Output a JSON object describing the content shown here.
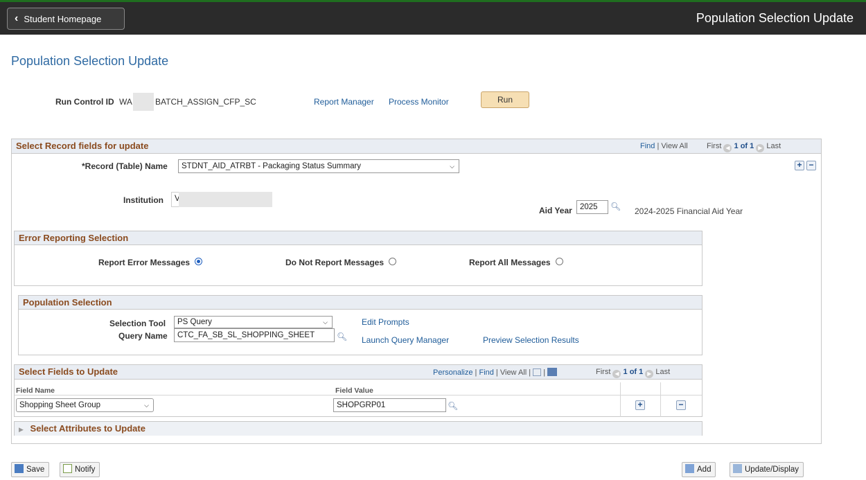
{
  "header": {
    "back_label": "Student Homepage",
    "title": "Population Selection Update"
  },
  "page_title": "Population Selection Update",
  "run_control": {
    "label": "Run Control ID",
    "value_prefix": "WA",
    "value_suffix": "BATCH_ASSIGN_CFP_SC",
    "report_manager": "Report Manager",
    "process_monitor": "Process Monitor",
    "run_label": "Run"
  },
  "record_section": {
    "title": "Select Record fields for update",
    "nav": {
      "find": "Find",
      "view_all": "View All",
      "first": "First",
      "count": "1 of 1",
      "last": "Last"
    },
    "record_label": "*Record (Table) Name",
    "record_value": "STDNT_AID_ATRBT - Packaging Status Summary",
    "institution_label": "Institution",
    "institution_value": "V",
    "aid_year_label": "Aid Year",
    "aid_year_value": "2025",
    "aid_year_desc": "2024-2025 Financial Aid Year"
  },
  "error_section": {
    "title": "Error Reporting Selection",
    "options": [
      "Report Error Messages",
      "Do Not Report Messages",
      "Report All Messages"
    ],
    "selected": "Report Error Messages"
  },
  "population_section": {
    "title": "Population Selection",
    "tool_label": "Selection Tool",
    "tool_value": "PS Query",
    "query_label": "Query Name",
    "query_value": "CTC_FA_SB_SL_SHOPPING_SHEET",
    "edit_prompts": "Edit Prompts",
    "launch_query_manager": "Launch Query Manager",
    "preview_results": "Preview Selection Results"
  },
  "fields_section": {
    "title": "Select Fields to Update",
    "nav": {
      "personalize": "Personalize",
      "find": "Find",
      "view_all": "View All",
      "first": "First",
      "count": "1 of 1",
      "last": "Last"
    },
    "col_field_name": "Field Name",
    "col_field_value": "Field Value",
    "rows": [
      {
        "field_name": "Shopping Sheet Group",
        "field_value": "SHOPGRP01"
      }
    ]
  },
  "attributes_section": {
    "title": "Select Attributes to Update"
  },
  "footer": {
    "save": "Save",
    "notify": "Notify",
    "add": "Add",
    "update_display": "Update/Display"
  },
  "colors": {
    "header_bg": "#2b2b2b",
    "link": "#1f5c99",
    "section_title": "#8a4b1f",
    "run_button": "#f6dfb4"
  }
}
